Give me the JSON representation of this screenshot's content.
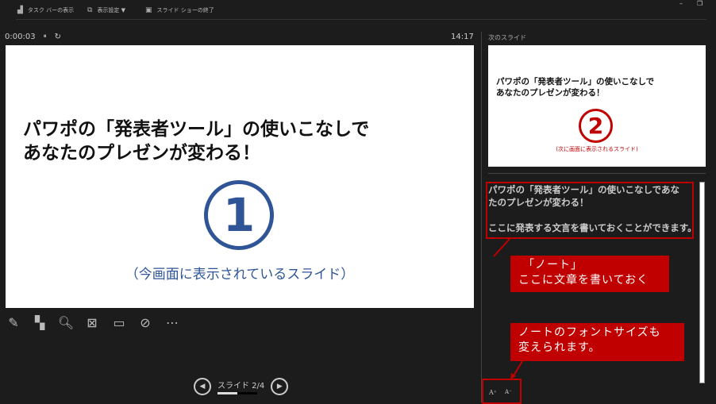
{
  "toolbar": {
    "taskbar": "タスク バーの表示",
    "display": "表示設定 ▼",
    "end": "スライド ショーの終了"
  },
  "window": {
    "minimize": "–",
    "restore": "❐"
  },
  "timer": {
    "elapsed": "0:00:03",
    "pause": "⏸",
    "reset": "↻",
    "clock": "14:17"
  },
  "current_slide": {
    "title_line1": "パワポの「発表者ツール」の使いこなしで",
    "title_line2": "あなたのプレゼンが変わる！",
    "number": "①",
    "caption": "（今画面に表示されているスライド）",
    "accent": "#2f5597"
  },
  "next_slide": {
    "label": "次のスライド",
    "title_line1": "パワポの「発表者ツール」の使いこなしで",
    "title_line2": "あなたのプレゼンが変わる！",
    "number": "②",
    "caption": "(次に画面に表示されるスライド)",
    "accent": "#c00000"
  },
  "tools": [
    "pen-icon",
    "all-slides-icon",
    "zoom-icon",
    "black-screen-icon",
    "subtitles-icon",
    "camera-off-icon",
    "more-icon"
  ],
  "nav": {
    "label": "スライド 2/4",
    "prev": "◀",
    "next": "▶",
    "progress": 0.5
  },
  "notes": {
    "line1": "パワポの「発表者ツール」の使いこなしであな",
    "line2": "たのプレゼンが変わる！",
    "line3": "ここに発表する文言を書いておくことができます。"
  },
  "callouts": {
    "note_line1": "「ノート」",
    "note_line2": "ここに文章を書いておく",
    "font_line1": "ノートのフォントサイズも",
    "font_line2": "変えられます。"
  },
  "font_controls": {
    "increase": "A⁺",
    "decrease": "A⁻"
  }
}
